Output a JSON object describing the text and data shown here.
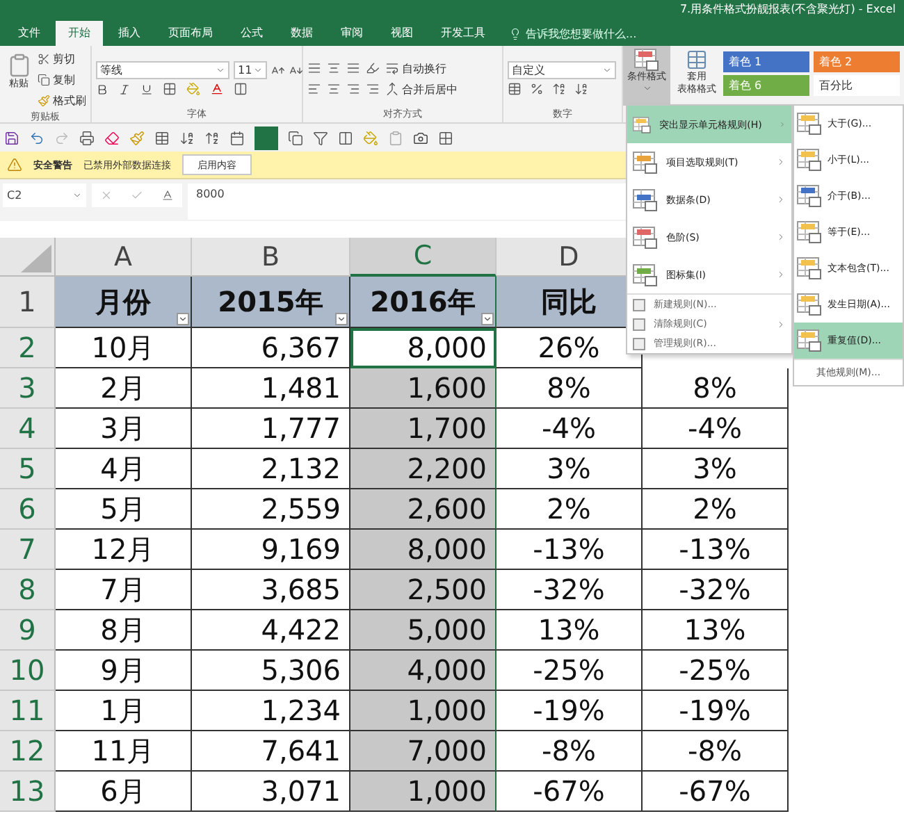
{
  "window": {
    "title": "7.用条件格式扮靓报表(不含聚光灯) - Excel"
  },
  "tabs": [
    {
      "label": "文件",
      "selected": false
    },
    {
      "label": "开始",
      "selected": true
    },
    {
      "label": "插入",
      "selected": false
    },
    {
      "label": "页面布局",
      "selected": false
    },
    {
      "label": "公式",
      "selected": false
    },
    {
      "label": "数据",
      "selected": false
    },
    {
      "label": "审阅",
      "selected": false
    },
    {
      "label": "视图",
      "selected": false
    },
    {
      "label": "开发工具",
      "selected": false
    }
  ],
  "tell_me": {
    "placeholder": "告诉我您想要做什么..."
  },
  "ribbon": {
    "clipboard": {
      "paste": "粘贴",
      "cut": "剪切",
      "copy": "复制",
      "painter": "格式刷",
      "group": "剪贴板"
    },
    "font": {
      "name": "等线",
      "size": "11",
      "group": "字体"
    },
    "alignment": {
      "wrap": "自动换行",
      "merge": "合并后居中",
      "group": "对齐方式"
    },
    "number": {
      "format": "自定义",
      "group": "数字"
    },
    "conditional_format": {
      "label": "条件格式",
      "pressed": true
    },
    "table_format": {
      "lines": [
        "套用",
        "表格格式"
      ]
    },
    "styles": [
      {
        "label": "着色 1",
        "color": "#4472c4"
      },
      {
        "label": "着色 2",
        "color": "#ed7d31"
      },
      {
        "label": "着色 6",
        "color": "#70ad47"
      },
      {
        "label": "百分比",
        "color": "#ffffff"
      }
    ]
  },
  "security_bar": {
    "title": "安全警告",
    "message": "已禁用外部数据连接",
    "button": "启用内容"
  },
  "formula_bar": {
    "name_box": "C2",
    "value": "8000"
  },
  "sheet": {
    "columns": [
      {
        "label": "A",
        "selected": false
      },
      {
        "label": "B",
        "selected": false
      },
      {
        "label": "C",
        "selected": true
      },
      {
        "label": "D",
        "selected": false
      },
      {}
    ],
    "rows": [
      {
        "number": "1",
        "selected": false,
        "active": false,
        "header": true,
        "cells": [
          "月份",
          "2015年",
          "2016年",
          "同比"
        ]
      },
      {
        "number": "2",
        "selected": true,
        "active": true,
        "header": false,
        "cells": [
          "10月",
          "6,367",
          "8,000",
          "26%",
          null
        ]
      },
      {
        "number": "3",
        "selected": true,
        "active": false,
        "header": false,
        "cells": [
          "2月",
          "1,481",
          "1,600",
          "8%",
          "8%"
        ]
      },
      {
        "number": "4",
        "selected": true,
        "active": false,
        "header": false,
        "cells": [
          "3月",
          "1,777",
          "1,700",
          "-4%",
          "-4%"
        ]
      },
      {
        "number": "5",
        "selected": true,
        "active": false,
        "header": false,
        "cells": [
          "4月",
          "2,132",
          "2,200",
          "3%",
          "3%"
        ]
      },
      {
        "number": "6",
        "selected": true,
        "active": false,
        "header": false,
        "cells": [
          "5月",
          "2,559",
          "2,600",
          "2%",
          "2%"
        ]
      },
      {
        "number": "7",
        "selected": true,
        "active": false,
        "header": false,
        "cells": [
          "12月",
          "9,169",
          "8,000",
          "-13%",
          "-13%"
        ]
      },
      {
        "number": "8",
        "selected": true,
        "active": false,
        "header": false,
        "cells": [
          "7月",
          "3,685",
          "2,500",
          "-32%",
          "-32%"
        ]
      },
      {
        "number": "9",
        "selected": true,
        "active": false,
        "header": false,
        "cells": [
          "8月",
          "4,422",
          "5,000",
          "13%",
          "13%"
        ]
      },
      {
        "number": "10",
        "selected": true,
        "active": false,
        "header": false,
        "cells": [
          "9月",
          "5,306",
          "4,000",
          "-25%",
          "-25%"
        ]
      },
      {
        "number": "11",
        "selected": true,
        "active": false,
        "header": false,
        "cells": [
          "1月",
          "1,234",
          "1,000",
          "-19%",
          "-19%"
        ]
      },
      {
        "number": "12",
        "selected": true,
        "active": false,
        "header": false,
        "cells": [
          "11月",
          "7,641",
          "7,000",
          "-8%",
          "-8%"
        ]
      },
      {
        "number": "13",
        "selected": true,
        "active": false,
        "header": false,
        "cells": [
          "6月",
          "3,071",
          "1,000",
          "-67%",
          "-67%"
        ]
      }
    ]
  },
  "menu": {
    "items": [
      {
        "label": "突出显示单元格规则(H)",
        "kind": "large",
        "selected": true,
        "submenu": true
      },
      {
        "label": "项目选取规则(T)",
        "kind": "large",
        "selected": false,
        "submenu": true
      },
      {
        "label": "数据条(D)",
        "kind": "large",
        "selected": false,
        "submenu": true
      },
      {
        "label": "色阶(S)",
        "kind": "large",
        "selected": false,
        "submenu": true
      },
      {
        "label": "图标集(I)",
        "kind": "large",
        "selected": false,
        "submenu": true
      },
      {
        "label": "新建规则(N)...",
        "kind": "small",
        "selected": false,
        "submenu": false
      },
      {
        "label": "清除规则(C)",
        "kind": "small",
        "selected": false,
        "submenu": true
      },
      {
        "label": "管理规则(R)...",
        "kind": "small",
        "selected": false,
        "submenu": false
      }
    ]
  },
  "submenu": {
    "items": [
      {
        "label": "大于(G)...",
        "selected": false
      },
      {
        "label": "小于(L)...",
        "selected": false
      },
      {
        "label": "介于(B)...",
        "selected": false
      },
      {
        "label": "等于(E)...",
        "selected": false
      },
      {
        "label": "文本包含(T)...",
        "selected": false
      },
      {
        "label": "发生日期(A)...",
        "selected": false
      },
      {
        "label": "重复值(D)...",
        "selected": true
      }
    ],
    "footer": "其他规则(M)..."
  }
}
